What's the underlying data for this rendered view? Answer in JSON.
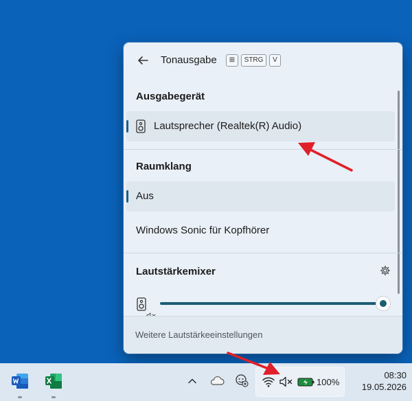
{
  "flyout": {
    "title": "Tonausgabe",
    "shortcut": [
      "⊞",
      "STRG",
      "V"
    ],
    "output_section": {
      "heading": "Ausgabegerät",
      "devices": [
        {
          "label": "Lautsprecher (Realtek(R) Audio)",
          "selected": true
        }
      ]
    },
    "spatial_section": {
      "heading": "Raumklang",
      "options": [
        {
          "label": "Aus",
          "selected": true
        },
        {
          "label": "Windows Sonic für Kopfhörer",
          "selected": false
        }
      ]
    },
    "mixer_section": {
      "heading": "Lautstärkemixer",
      "volume_percent": 100,
      "muted": true
    },
    "footer_link": "Weitere Lautstärkeeinstellungen"
  },
  "taskbar": {
    "apps": [
      {
        "name": "Word",
        "icon": "word-icon",
        "color": "#185abd"
      },
      {
        "name": "Excel",
        "icon": "excel-icon",
        "color": "#107c41"
      }
    ],
    "tray": {
      "icons": [
        "chevron-up-icon",
        "onedrive-cloud-icon",
        "copilot-icon",
        "wifi-icon",
        "speaker-muted-icon",
        "battery-charging-icon"
      ],
      "battery_percent": "100%"
    },
    "clock": {
      "time": "08:30",
      "date": "19.05.2026"
    }
  },
  "annotations": {
    "arrow_color": "#e0202a"
  },
  "colors": {
    "desktop": "#0a62b9",
    "accent": "#1d5e72"
  }
}
